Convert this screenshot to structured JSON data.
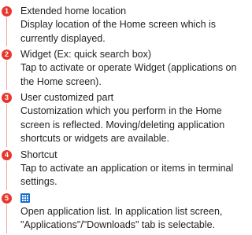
{
  "items": [
    {
      "number": "1",
      "title": "Extended home location",
      "desc_lines": [
        "Display location of the Home screen which is",
        "currently displayed."
      ]
    },
    {
      "number": "2",
      "title": "Widget (Ex: quick search box)",
      "desc_lines": [
        "Tap to activate or operate Widget (applications on",
        "the Home screen)."
      ]
    },
    {
      "number": "3",
      "title": "User customized part",
      "desc_lines": [
        "Customization which you perform in the Home",
        "screen is reflected. Moving/deleting application",
        "shortcuts or widgets are available."
      ]
    },
    {
      "number": "4",
      "title": "Shortcut",
      "desc_lines": [
        "Tap to activate an application or items in terminal",
        "settings."
      ]
    },
    {
      "number": "5",
      "icon": "app-list-grid-icon",
      "desc_lines": [
        "Open application list. In application list screen,",
        "\"Applications\"/\"Downloads\" tab is selectable."
      ]
    }
  ],
  "colors": {
    "number_badge": "#e8362c",
    "rail": "#f0a49f",
    "grid_icon": "#1a6fc9",
    "text": "#231f20"
  }
}
